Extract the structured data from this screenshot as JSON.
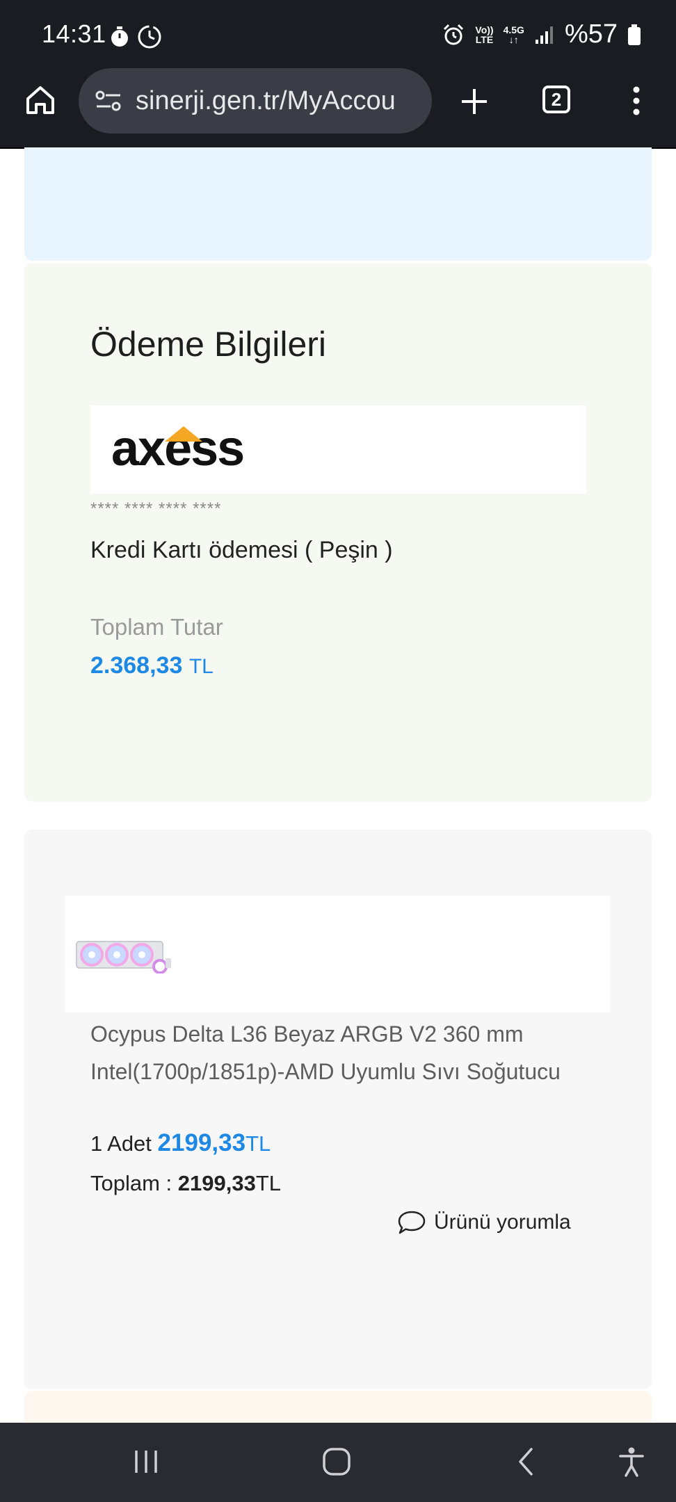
{
  "status_bar": {
    "time": "14:31",
    "volte_top": "Vo))",
    "volte_bottom": "LTE",
    "network": "4.5G",
    "battery": "%57"
  },
  "browser": {
    "url": "sinerji.gen.tr/MyAccou",
    "tab_count": "2"
  },
  "payment": {
    "title": "Ödeme Bilgileri",
    "bank_logo_text": "axess",
    "masked_card": "**** **** **** ****",
    "method": "Kredi Kartı ödemesi ( Peşin )",
    "total_label": "Toplam Tutar",
    "total_amount": "2.368,33",
    "currency": "TL"
  },
  "product": {
    "name": "Ocypus Delta L36 Beyaz ARGB V2 360 mm Intel(1700p/1851p)-AMD Uyumlu Sıvı Soğutucu",
    "qty_label": "1 Adet",
    "unit_price": "2199,33",
    "currency": "TL",
    "total_label": "Toplam :",
    "total_value": "2199,33",
    "comment_label": "Ürünü yorumla"
  },
  "colors": {
    "accent": "#1e88e5",
    "status_bg": "#1b1c21",
    "payment_card_bg": "#f6f9f1",
    "product_card_bg": "#f7f7f7",
    "axess_orange": "#f5a623"
  }
}
